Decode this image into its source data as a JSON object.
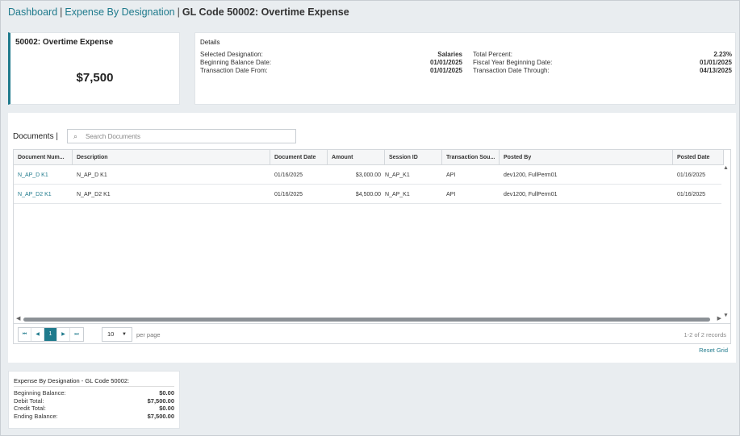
{
  "breadcrumb": {
    "items": [
      "Dashboard",
      "Expense By Designation"
    ],
    "current": "GL Code 50002: Overtime Expense",
    "separator": "|"
  },
  "summary": {
    "title": "50002: Overtime Expense",
    "amount": "$7,500"
  },
  "details": {
    "title": "Details",
    "rows": [
      {
        "label1": "Selected Designation:",
        "value1": "Salaries",
        "label2": "Total Percent:",
        "value2": "2.23%"
      },
      {
        "label1": "Beginning Balance Date:",
        "value1": "01/01/2025",
        "label2": "Fiscal Year Beginning Date:",
        "value2": "01/01/2025"
      },
      {
        "label1": "Transaction Date From:",
        "value1": "01/01/2025",
        "label2": "Transaction Date Through:",
        "value2": "04/13/2025"
      }
    ]
  },
  "documents": {
    "label": "Documents |",
    "search_placeholder": "Search Documents",
    "columns": [
      "Document Num...",
      "Description",
      "Document Date",
      "Amount",
      "Session ID",
      "Transaction Sou...",
      "Posted By",
      "Posted Date"
    ],
    "rows": [
      [
        "N_AP_D K1",
        "N_AP_D K1",
        "01/16/2025",
        "$3,000.00",
        "N_AP_K1",
        "API",
        "dev1200, FullPerm01",
        "01/16/2025"
      ],
      [
        "N_AP_D2 K1",
        "N_AP_D2 K1",
        "01/16/2025",
        "$4,500.00",
        "N_AP_K1",
        "API",
        "dev1200, FullPerm01",
        "01/16/2025"
      ]
    ],
    "pager": {
      "first": "⏮",
      "prev": "◀",
      "current_page": "1",
      "next": "▶",
      "last": "⏭",
      "page_size": "10",
      "per_page_label": "per page",
      "records": "1-2 of 2 records"
    },
    "reset_grid": "Reset Grid"
  },
  "bottom_summary": {
    "title": "Expense By Designation - GL Code 50002:",
    "rows": [
      {
        "label": "Beginning Balance:",
        "value": "$0.00"
      },
      {
        "label": "Debit Total:",
        "value": "$7,500.00"
      },
      {
        "label": "Credit Total:",
        "value": "$0.00"
      },
      {
        "label": "Ending Balance:",
        "value": "$7,500.00"
      }
    ]
  },
  "colors": {
    "accent": "#1f7a8c",
    "background": "#e9edf0"
  },
  "icons": {
    "search": "search-icon"
  }
}
